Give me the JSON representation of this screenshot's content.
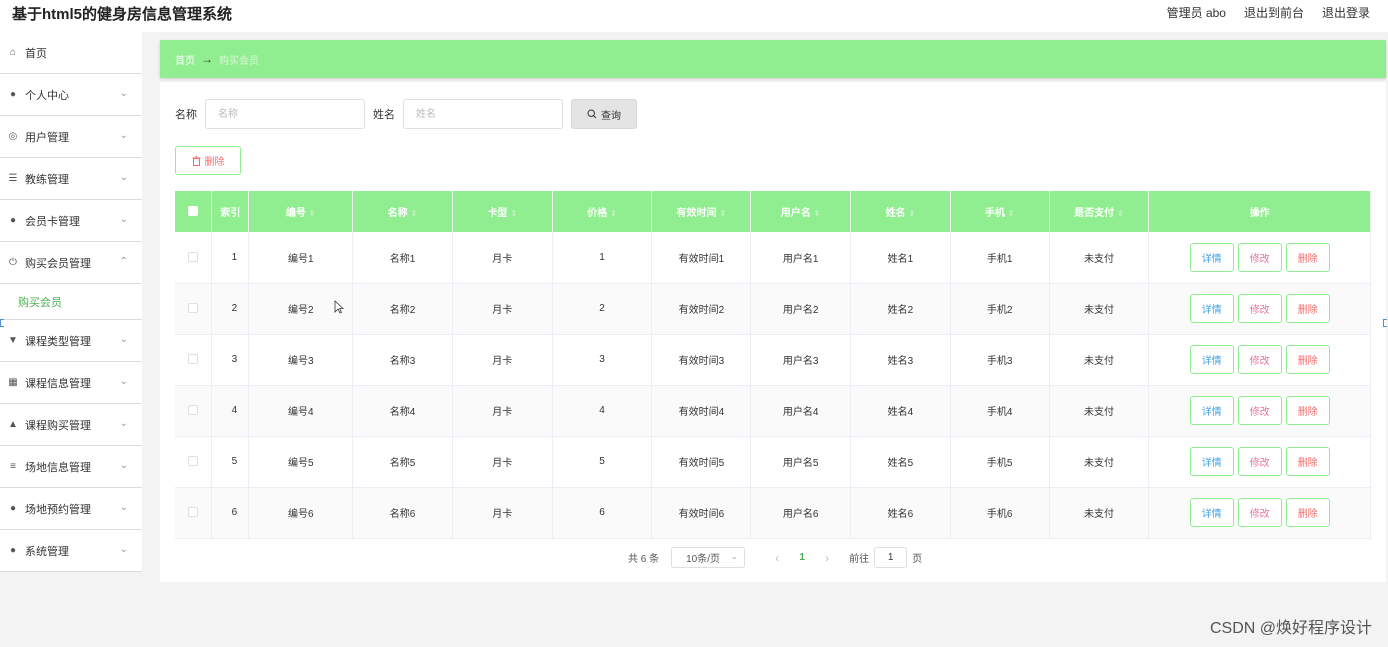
{
  "header": {
    "title": "基于html5的健身房信息管理系统",
    "admin": "管理员 abo",
    "back_front": "退出到前台",
    "logout": "退出登录"
  },
  "sidebar": {
    "items": [
      {
        "label": "首页",
        "icon": "home-icon"
      },
      {
        "label": "个人中心",
        "icon": "user-icon"
      },
      {
        "label": "用户管理",
        "icon": "globe-icon"
      },
      {
        "label": "教练管理",
        "icon": "sliders-icon"
      },
      {
        "label": "会员卡管理",
        "icon": "user-icon"
      },
      {
        "label": "购买会员管理",
        "icon": "power-icon",
        "sub": "购买会员"
      },
      {
        "label": "课程类型管理",
        "icon": "chat-icon"
      },
      {
        "label": "课程信息管理",
        "icon": "chart-icon"
      },
      {
        "label": "课程购买管理",
        "icon": "thumb-icon"
      },
      {
        "label": "场地信息管理",
        "icon": "list-icon"
      },
      {
        "label": "场地预约管理",
        "icon": "user-icon"
      },
      {
        "label": "系统管理",
        "icon": "mic-icon"
      }
    ]
  },
  "breadcrumb": {
    "home": "首页",
    "current": "购买会员"
  },
  "search": {
    "name_label": "名称",
    "name_placeholder": "名称",
    "person_label": "姓名",
    "person_placeholder": "姓名",
    "query_label": "查询"
  },
  "delete_label": "删除",
  "table": {
    "headers": [
      "索引",
      "编号",
      "名称",
      "卡型",
      "价格",
      "有效时间",
      "用户名",
      "姓名",
      "手机",
      "是否支付",
      "操作"
    ],
    "rows": [
      [
        "1",
        "编号1",
        "名称1",
        "月卡",
        "1",
        "有效时间1",
        "用户名1",
        "姓名1",
        "手机1",
        "未支付"
      ],
      [
        "2",
        "编号2",
        "名称2",
        "月卡",
        "2",
        "有效时间2",
        "用户名2",
        "姓名2",
        "手机2",
        "未支付"
      ],
      [
        "3",
        "编号3",
        "名称3",
        "月卡",
        "3",
        "有效时间3",
        "用户名3",
        "姓名3",
        "手机3",
        "未支付"
      ],
      [
        "4",
        "编号4",
        "名称4",
        "月卡",
        "4",
        "有效时间4",
        "用户名4",
        "姓名4",
        "手机4",
        "未支付"
      ],
      [
        "5",
        "编号5",
        "名称5",
        "月卡",
        "5",
        "有效时间5",
        "用户名5",
        "姓名5",
        "手机5",
        "未支付"
      ],
      [
        "6",
        "编号6",
        "名称6",
        "月卡",
        "6",
        "有效时间6",
        "用户名6",
        "姓名6",
        "手机6",
        "未支付"
      ]
    ],
    "ops": {
      "detail": "详情",
      "edit": "修改",
      "remove": "删除"
    }
  },
  "pager": {
    "total": "共 6 条",
    "page_size": "10条/页",
    "current_page": "1",
    "goto": "前往",
    "goto_value": "1",
    "page_unit": "页"
  },
  "watermark": "CSDN @焕好程序设计",
  "colors": {
    "accent": "#90ee90",
    "link_green": "#4caf50",
    "danger": "#f56c6c"
  }
}
